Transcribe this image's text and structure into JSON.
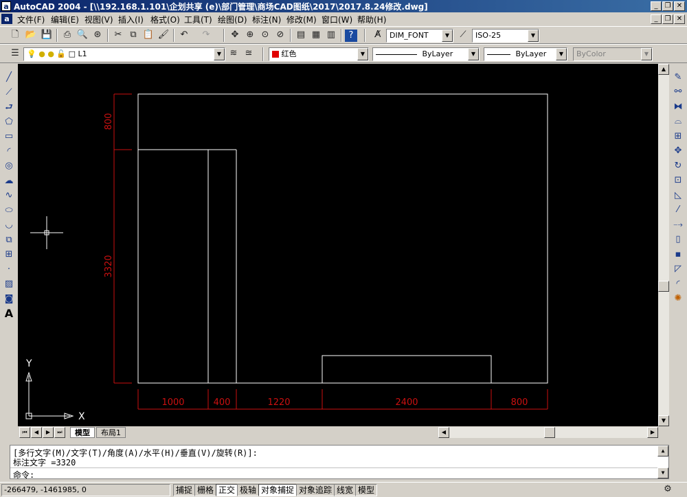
{
  "window": {
    "app_icon": "a",
    "title": "AutoCAD 2004 - [\\\\192.168.1.101\\企划共享 (e)\\部门管理\\商场CAD图纸\\2017\\2017.8.24修改.dwg]"
  },
  "menu": [
    "文件(F)",
    "编辑(E)",
    "视图(V)",
    "插入(I)",
    "格式(O)",
    "工具(T)",
    "绘图(D)",
    "标注(N)",
    "修改(M)",
    "窗口(W)",
    "帮助(H)"
  ],
  "toolbar": {
    "text_style": "DIM_FONT",
    "dim_style": "ISO-25",
    "layer": "L1",
    "color": "红色",
    "linetype": "ByLayer",
    "lineweight": "ByLayer",
    "plotstyle": "ByColor"
  },
  "drawing": {
    "dim_vertical": [
      "800",
      "3320"
    ],
    "dim_horizontal": [
      "1000",
      "400",
      "1220",
      "2400",
      "800"
    ],
    "ucs_x": "X",
    "ucs_y": "Y",
    "colors": {
      "geometry": "#ffffff",
      "dimension": "#cc1010",
      "background": "#000000"
    }
  },
  "tabs": [
    "模型",
    "布局1"
  ],
  "command": {
    "line1": "[多行文字(M)/文字(T)/角度(A)/水平(H)/垂直(V)/旋转(R)]:",
    "line2": "标注文字 =3320",
    "prompt": "命令:"
  },
  "status": {
    "coords": "-266479, -1461985, 0",
    "toggles": [
      "捕捉",
      "栅格",
      "正交",
      "极轴",
      "对象捕捉",
      "对象追踪",
      "线宽",
      "模型"
    ]
  }
}
